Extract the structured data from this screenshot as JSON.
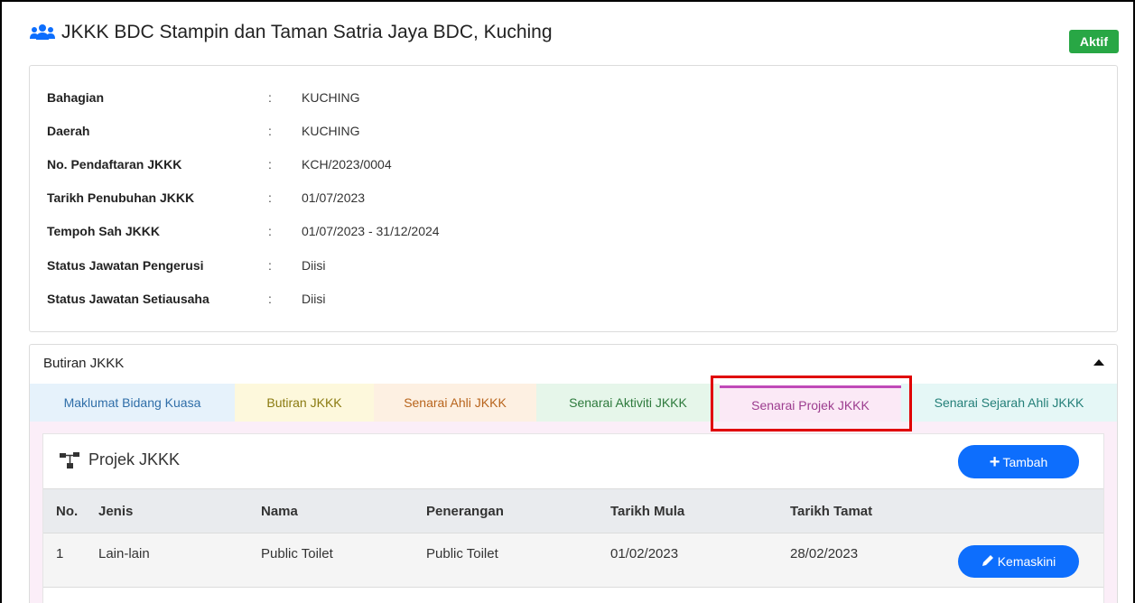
{
  "header": {
    "title": "JKKK BDC Stampin dan Taman Satria Jaya BDC, Kuching",
    "icon": "users-icon",
    "status_badge": "Aktif",
    "badge_color": "#28a745"
  },
  "info": {
    "rows": [
      {
        "label": "Bahagian",
        "colon": ":",
        "value": "KUCHING"
      },
      {
        "label": "Daerah",
        "colon": ":",
        "value": "KUCHING"
      },
      {
        "label": "No. Pendaftaran JKKK",
        "colon": ":",
        "value": "KCH/2023/0004"
      },
      {
        "label": "Tarikh Penubuhan JKKK",
        "colon": ":",
        "value": "01/07/2023"
      },
      {
        "label": "Tempoh Sah JKKK",
        "colon": ":",
        "value": "01/07/2023 - 31/12/2024"
      },
      {
        "label": "Status Jawatan Pengerusi",
        "colon": ":",
        "value": "Diisi"
      },
      {
        "label": "Status Jawatan Setiausaha",
        "colon": ":",
        "value": "Diisi"
      }
    ]
  },
  "details": {
    "heading": "Butiran JKKK",
    "collapse_icon": "caret-up-icon",
    "tabs": [
      {
        "label": "Maklumat Bidang Kuasa"
      },
      {
        "label": "Butiran JKKK"
      },
      {
        "label": "Senarai Ahli JKKK"
      },
      {
        "label": "Senarai Aktiviti JKKK"
      },
      {
        "label": "Senarai Projek JKKK",
        "active": true
      },
      {
        "label": "Senarai Sejarah Ahli JKKK"
      }
    ]
  },
  "projects": {
    "title": "Projek JKKK",
    "icon": "sitemap-icon",
    "add_button": "Tambah",
    "columns": [
      "No.",
      "Jenis",
      "Nama",
      "Penerangan",
      "Tarikh Mula",
      "Tarikh Tamat"
    ],
    "rows": [
      {
        "no": "1",
        "jenis": "Lain-lain",
        "nama": "Public Toilet",
        "penerangan": "Public Toilet",
        "mula": "01/02/2023",
        "tamat": "28/02/2023",
        "action": "Kemaskini"
      }
    ],
    "button_color": "#0d6efd"
  },
  "annotation": {
    "highlight_color": "#e00000"
  }
}
